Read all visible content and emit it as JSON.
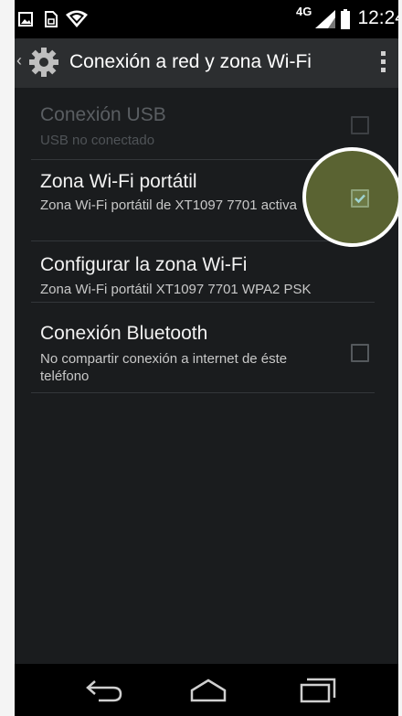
{
  "status_bar": {
    "network_label": "4G",
    "time": "12:24",
    "icons": [
      "image-notification-icon",
      "sim-icon",
      "wifi-icon",
      "signal-icon",
      "battery-icon"
    ]
  },
  "action_bar": {
    "title": "Conexión a red y zona Wi-Fi",
    "icons": [
      "back-chevron-icon",
      "settings-gear-icon",
      "overflow-menu-icon"
    ]
  },
  "settings": [
    {
      "title": "Conexión USB",
      "summary": "USB no conectado",
      "enabled": false,
      "checkbox": true,
      "checked": false
    },
    {
      "title": "Zona Wi-Fi portátil",
      "summary": "Zona Wi-Fi portátil de XT1097 7701 activa",
      "enabled": true,
      "checkbox": true,
      "checked": true
    },
    {
      "title": "Configurar la zona Wi-Fi",
      "summary": "Zona Wi-Fi portátil XT1097 7701 WPA2 PSK",
      "enabled": true,
      "checkbox": false,
      "checked": false
    },
    {
      "title": "Conexión Bluetooth",
      "summary": "No compartir conexión a internet de éste teléfono",
      "enabled": true,
      "checkbox": true,
      "checked": false
    }
  ],
  "nav_bar": {
    "icons": [
      "back-icon",
      "home-icon",
      "recent-apps-icon"
    ]
  },
  "colors": {
    "background": "#1a1c1e",
    "action_bar": "#2c2e30",
    "highlight": "#5a6332",
    "check_accent": "#33b5e5"
  }
}
